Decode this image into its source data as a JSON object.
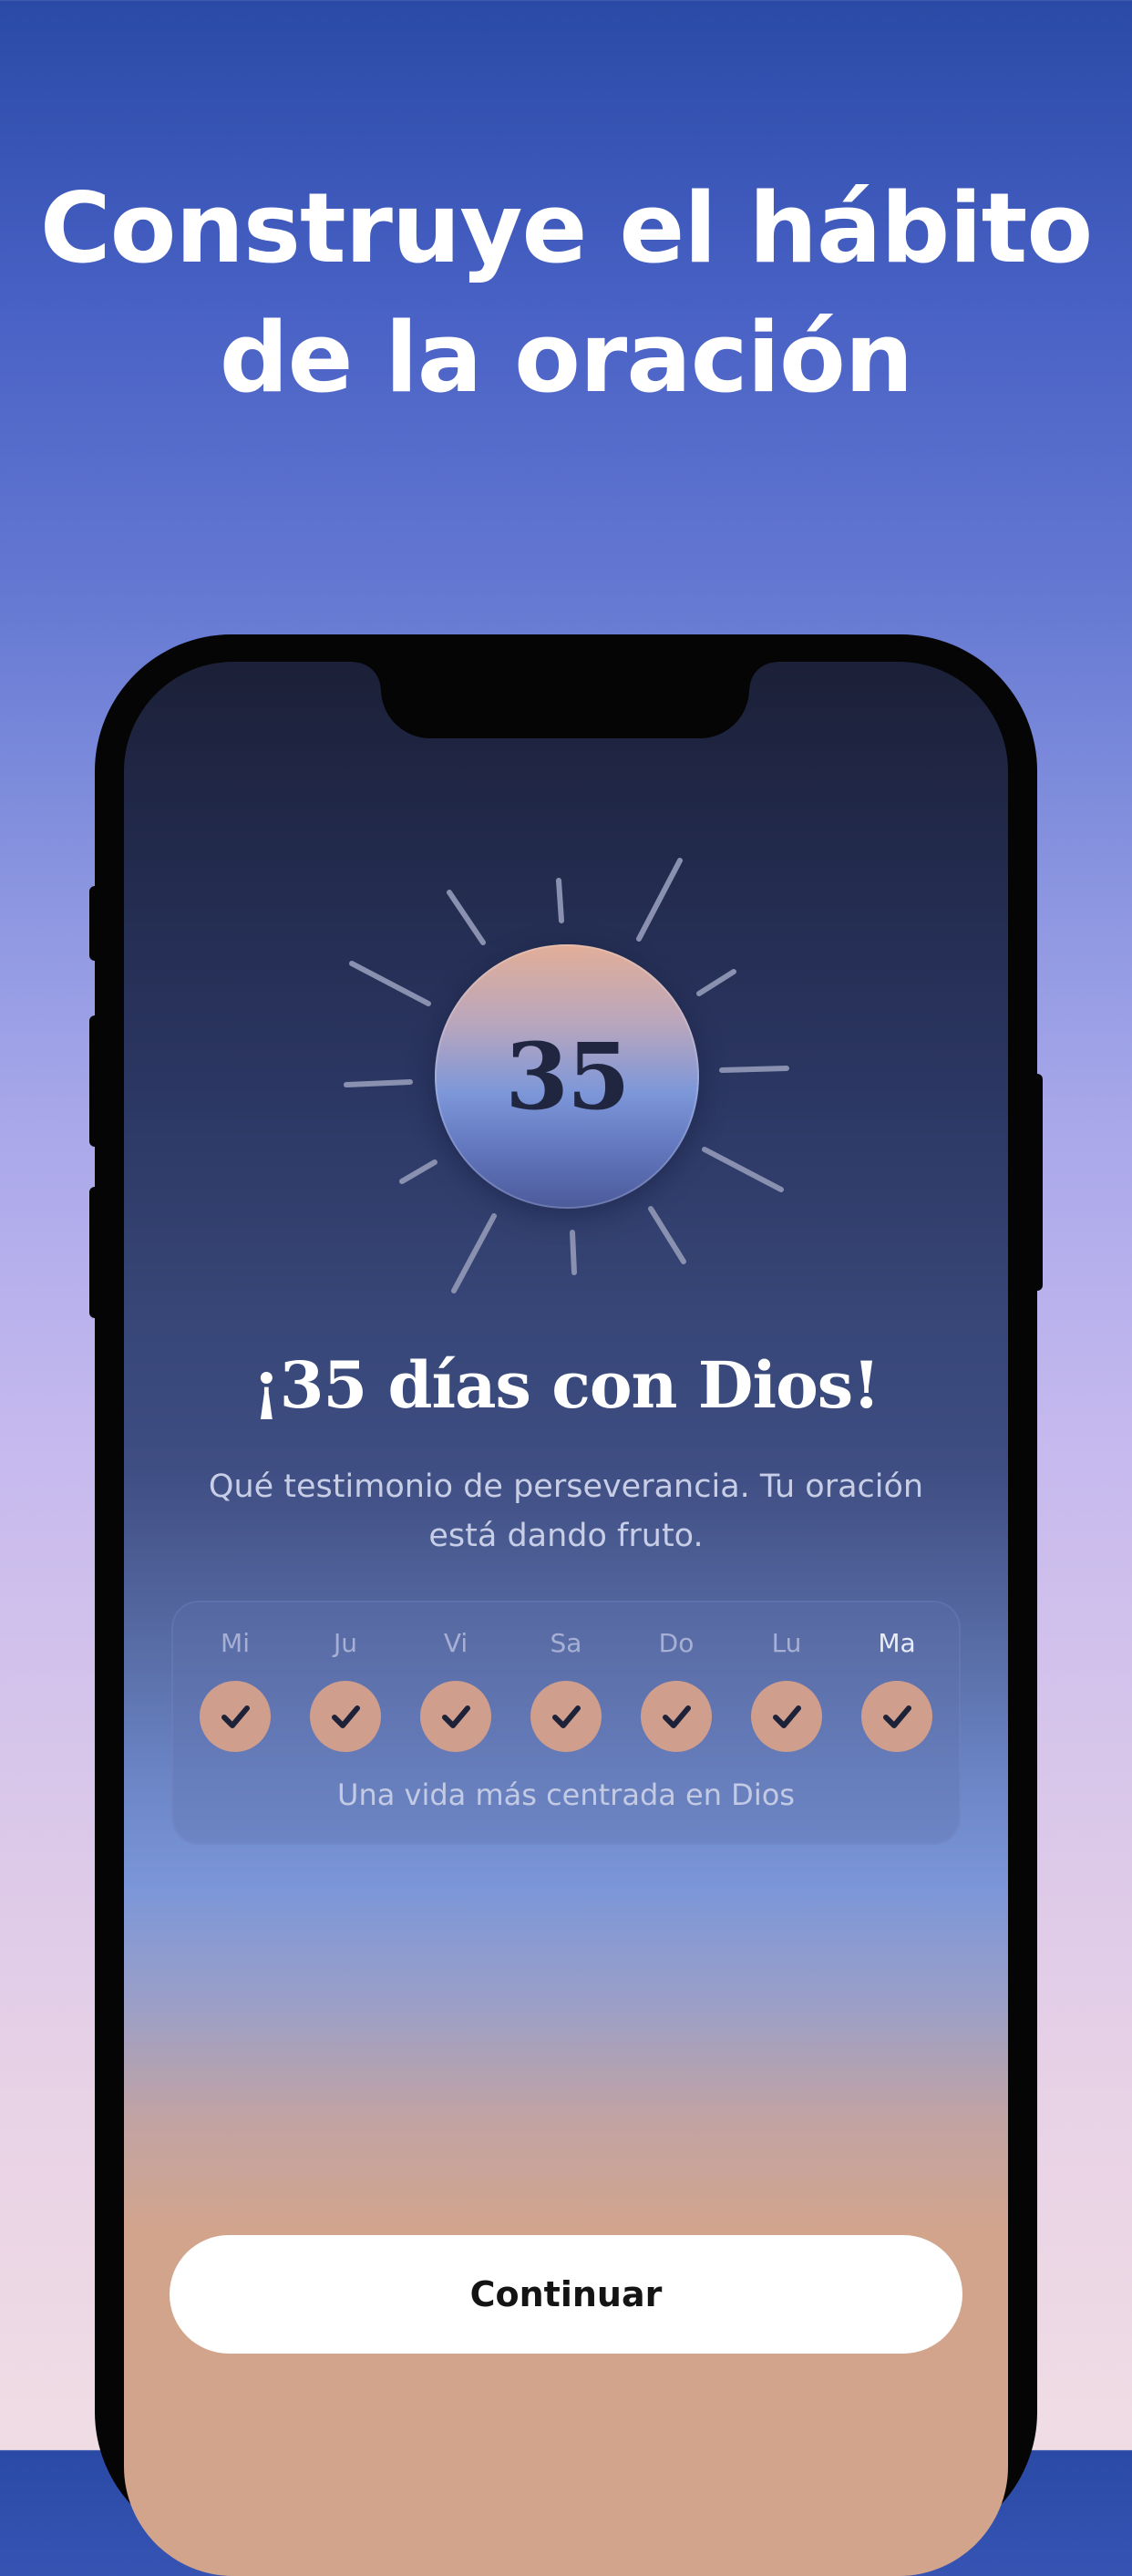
{
  "headline": {
    "line1": "Construye el hábito",
    "line2": "de la oración"
  },
  "streak": {
    "number": "35",
    "title": "¡35 días con Dios!",
    "subtitle": "Qué testimonio de perseverancia. Tu oración está dando fruto."
  },
  "week": {
    "days": [
      {
        "label": "Mi",
        "completed": true
      },
      {
        "label": "Ju",
        "completed": true
      },
      {
        "label": "Vi",
        "completed": true
      },
      {
        "label": "Sa",
        "completed": true
      },
      {
        "label": "Do",
        "completed": true
      },
      {
        "label": "Lu",
        "completed": true
      },
      {
        "label": "Ma",
        "completed": true
      }
    ],
    "caption": "Una vida más centrada en Dios"
  },
  "cta": {
    "label": "Continuar"
  },
  "colors": {
    "check_circle": "#cf9e8c",
    "check_mark": "#1d2238",
    "ray": "#8a91b0"
  }
}
